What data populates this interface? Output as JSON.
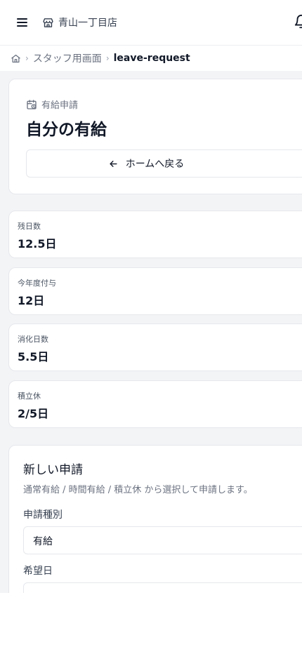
{
  "header": {
    "store_name": "青山一丁目店",
    "icons": {
      "menu": "hamburger-icon",
      "store": "store-icon",
      "notifications": "bell-icon"
    }
  },
  "breadcrumb": {
    "parent": "スタッフ用画面",
    "current": "leave-request"
  },
  "hero": {
    "subtitle": "有給申請",
    "title": "自分の有給",
    "back_button": "ホームへ戻る"
  },
  "stats": [
    {
      "label": "残日数",
      "value": "12.5日"
    },
    {
      "label": "今年度付与",
      "value": "12日"
    },
    {
      "label": "消化日数",
      "value": "5.5日"
    },
    {
      "label": "積立休",
      "value": "2/5日"
    }
  ],
  "form": {
    "title": "新しい申請",
    "description": "通常有給 / 時間有給 / 積立休 から選択して申請します。",
    "type_label": "申請種別",
    "type_value": "有給",
    "date_label": "希望日"
  },
  "colors": {
    "text": "#111827",
    "muted": "#6b7280",
    "border": "#e5e7eb",
    "background": "#f3f4f6"
  }
}
